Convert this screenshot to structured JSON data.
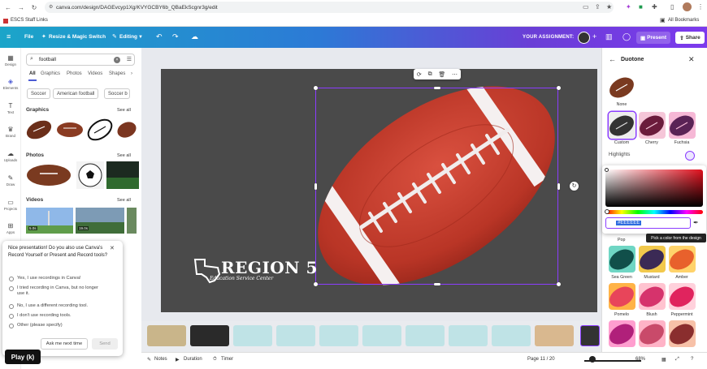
{
  "browser": {
    "url": "canva.com/design/DAGEvcyp1Xg/KVYGCBY6b_QBaEkScgnr3g/edit",
    "bookmarks": [
      "ESCS Staff Links",
      "All Bookmarks"
    ]
  },
  "toolbar": {
    "file": "File",
    "resize": "Resize & Magic Switch",
    "editing": "Editing",
    "assignment": "YOUR ASSIGNMENT:",
    "present": "Present",
    "share": "Share"
  },
  "rail": [
    {
      "label": "Design",
      "icon": "design-icon"
    },
    {
      "label": "Elements",
      "icon": "elements-icon"
    },
    {
      "label": "Text",
      "icon": "text-icon"
    },
    {
      "label": "Brand",
      "icon": "brand-icon"
    },
    {
      "label": "Uploads",
      "icon": "upload-icon"
    },
    {
      "label": "Draw",
      "icon": "draw-icon"
    },
    {
      "label": "Projects",
      "icon": "folder-icon"
    },
    {
      "label": "Apps",
      "icon": "apps-icon"
    }
  ],
  "panel": {
    "search_value": "football",
    "tabs": [
      "All",
      "Graphics",
      "Photos",
      "Videos",
      "Shapes"
    ],
    "chips": [
      "Soccer",
      "American football",
      "Soccer b"
    ],
    "sections": {
      "graphics": "Graphics",
      "photos": "Photos",
      "videos": "Videos",
      "see_all": "See all"
    },
    "video_durations": [
      "5.0s",
      "19.0s"
    ]
  },
  "popup": {
    "question": "Nice presentation! Do you also use Canva's Record Yourself or Present and Record tools?",
    "options": [
      "Yes, I use recordings in Canva!",
      "I tried recording in Canva, but no longer use it.",
      "No, I use a different recording tool.",
      "I don't use recording tools.",
      "Other (please specify)"
    ],
    "ask_later": "Ask me next time",
    "send": "Send"
  },
  "play_badge": "Play (k)",
  "slide": {
    "logo_title": "REGION 5",
    "logo_sub": "Education Service Center"
  },
  "bottom": {
    "notes": "Notes",
    "duration": "Duration",
    "timer": "Timer",
    "page": "Page 11 / 20",
    "zoom": "68%"
  },
  "right_panel": {
    "title": "Duotone",
    "swatches_top": [
      "None"
    ],
    "swatches_row2": [
      "Custom",
      "Cherry",
      "Fuchsia"
    ],
    "highlights": "Highlights",
    "hex_value": "#EEEEEE",
    "tooltip": "Pick a color from the design",
    "row_pop": "Pop",
    "swatches_row4": [
      "Sea Green",
      "Mustard",
      "Amber"
    ],
    "swatches_row5": [
      "Pomelo",
      "Blush",
      "Peppermint"
    ]
  },
  "colors": {
    "accent": "#8b3dff",
    "ball": "#c0392b",
    "slide_bg": "#4a4a4a"
  }
}
